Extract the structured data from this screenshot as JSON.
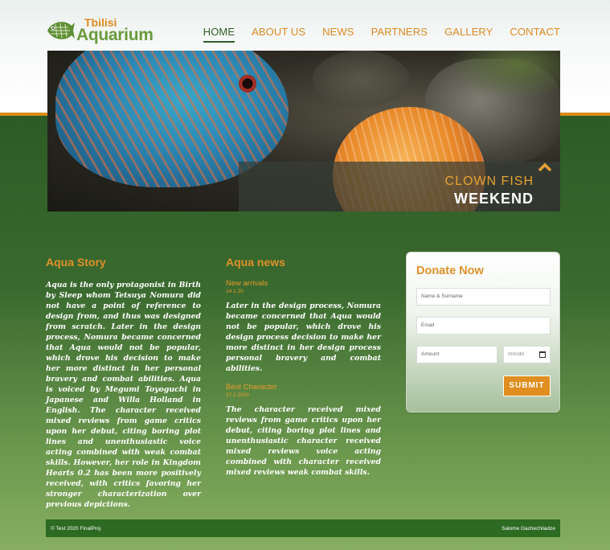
{
  "brand": {
    "small": "Tbilisi",
    "big": "Aquarium",
    "logo_icon": "fish-icon"
  },
  "nav": {
    "items": [
      {
        "label": "HOME",
        "active": true
      },
      {
        "label": "ABOUT US",
        "active": false
      },
      {
        "label": "NEWS",
        "active": false
      },
      {
        "label": "PARTNERS",
        "active": false
      },
      {
        "label": "GALLERY",
        "active": false
      },
      {
        "label": "CONTACT",
        "active": false
      }
    ]
  },
  "hero": {
    "caption_line1": "CLOWN FISH",
    "caption_line2": "WEEKEND",
    "caption_icon": "chevron-up-icon"
  },
  "story": {
    "title": "Aqua Story",
    "text": "Aqua is the only protagonist in Birth by Sleep whom Tetsuya Nomura did not have a point of reference to design from, and thus was designed from scratch. Later in the design process, Nomura became concerned that Aqua would not be popular, which drove his decision to make her more distinct in her personal bravery and combat abilities. Aqua is voiced by Megumi Toyoguchi in Japanese and Willa Holland in English. The character received mixed reviews from game critics upon her debut, citing boring plot lines and unenthusiastic voice acting combined with weak combat skills. However, her role in Kingdom Hearts 0.2 has been more positively received, with critics favoring her stronger characterization over previous depictions."
  },
  "news": {
    "title": "Aqua news",
    "items": [
      {
        "title": "New arrivals",
        "date": "14.1.20",
        "text": "Later in the design process, Nomura became concerned that Aqua would not be popular, which drove his design process decision to make her more distinct in her design process personal bravery and combat abilities."
      },
      {
        "title": "Best Character",
        "date": "27.1.2020",
        "text": "The character received mixed reviews from game critics upon her debut, citing boring plot lines and unenthusiastic character received mixed reviews voice acting combined with character received mixed reviews weak combat skills."
      }
    ]
  },
  "donate": {
    "title": "Donate Now",
    "name_placeholder": "Name & Surname",
    "email_placeholder": "Email",
    "amount_placeholder": "Amount",
    "date_placeholder": "mm/dd",
    "date_icon": "calendar-icon",
    "submit_label": "SUBMIT"
  },
  "footer": {
    "left": "© Test 2020 FinalProj",
    "right": "Salome Gachechiladze"
  },
  "colors": {
    "accent": "#e0902a",
    "dark_green": "#2f5e27",
    "footer_green": "#2d6a22"
  }
}
